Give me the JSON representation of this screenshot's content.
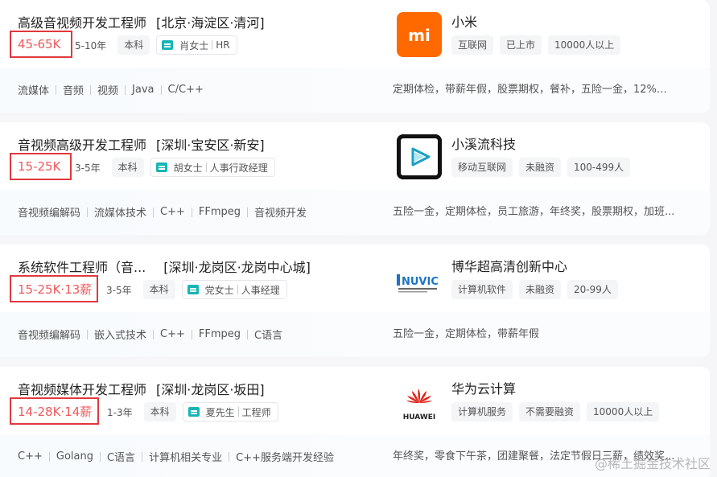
{
  "jobs": [
    {
      "title": "高级音视频开发工程师",
      "location": "[北京·海淀区·清河]",
      "salary": "45-65K",
      "experience": "5-10年",
      "education": "本科",
      "recruiter": "肖女士",
      "recruiter_role": "HR",
      "skills": [
        "流媒体",
        "音频",
        "视频",
        "Java",
        "C/C++"
      ],
      "company": "小米",
      "company_tags": [
        "互联网",
        "已上市",
        "10000人以上"
      ],
      "benefits": "定期体检，带薪年假，股票期权，餐补，五险一金，12%公..."
    },
    {
      "title": "音视频高级开发工程师",
      "location": "[深圳·宝安区·新安]",
      "salary": "15-25K",
      "experience": "3-5年",
      "education": "本科",
      "recruiter": "胡女士",
      "recruiter_role": "人事行政经理",
      "skills": [
        "音视频编解码",
        "流媒体技术",
        "C++",
        "FFmpeg",
        "音视频开发"
      ],
      "company": "小溪流科技",
      "company_tags": [
        "移动互联网",
        "未融资",
        "100-499人"
      ],
      "benefits": "五险一金，定期体检，员工旅游，年终奖，股票期权，加班..."
    },
    {
      "title": "系统软件工程师（音...",
      "location": "[深圳·龙岗区·龙岗中心城]",
      "salary": "15-25K·13薪",
      "experience": "3-5年",
      "education": "本科",
      "recruiter": "党女士",
      "recruiter_role": "人事经理",
      "skills": [
        "音视频编解码",
        "嵌入式技术",
        "C++",
        "FFmpeg",
        "C语言"
      ],
      "company": "博华超高清创新中心",
      "company_tags": [
        "计算机软件",
        "未融资",
        "20-99人"
      ],
      "benefits": "五险一金，定期体检，带薪年假"
    },
    {
      "title": "音视频媒体开发工程师",
      "location": "[深圳·龙岗区·坂田]",
      "salary": "14-28K·14薪",
      "experience": "1-3年",
      "education": "本科",
      "recruiter": "夏先生",
      "recruiter_role": "工程师",
      "skills": [
        "C++",
        "Golang",
        "C语言",
        "计算机相关专业",
        "C++服务端开发经验"
      ],
      "company": "华为云计算",
      "company_tags": [
        "计算机服务",
        "不需要融资",
        "10000人以上"
      ],
      "benefits": "年终奖，零食下午茶，团建聚餐，法定节假日三薪，绩效奖..."
    }
  ],
  "logos": {
    "xiaomi": {
      "text": "mi",
      "color": "#ff6900"
    },
    "xiaoxiliu": {
      "color": "#1f9fc4"
    },
    "bohua": {
      "text": "NUVIC",
      "color": "#1a73c7"
    },
    "huawei": {
      "text": "HUAWEI",
      "color": "#e0251b"
    }
  },
  "watermark": "@稀土掘金技术社区",
  "colors": {
    "salary": "#f0595c",
    "highlight_box": "#e0383e",
    "accent": "#17b5b5"
  }
}
